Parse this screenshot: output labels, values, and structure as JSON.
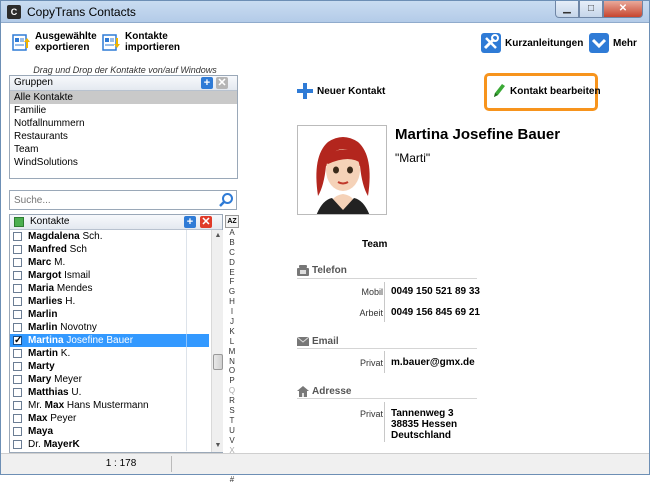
{
  "window": {
    "title": "CopyTrans Contacts",
    "icon": "C"
  },
  "toolbar": {
    "export_label_1": "Ausgewählte",
    "export_label_2": "exportieren",
    "import_label_1": "Kontakte",
    "import_label_2": "importieren",
    "guides_label": "Kurzanleitungen",
    "more_label": "Mehr"
  },
  "drag_note": "Drag und Drop der Kontakte von/auf Windows",
  "groups": {
    "header": "Gruppen",
    "items": [
      "Alle Kontakte",
      "Familie",
      "Notfallnummern",
      "Restaurants",
      "Team",
      "WindSolutions"
    ]
  },
  "search": {
    "placeholder": "Suche..."
  },
  "contacts": {
    "header": "Kontakte",
    "sort_label": "AZ",
    "rows": [
      {
        "bold": "Magdalena",
        "rest": " Sch.",
        "checked": false,
        "selected": false
      },
      {
        "bold": "Manfred",
        "rest": " Sch",
        "checked": false,
        "selected": false
      },
      {
        "bold": "Marc",
        "rest": " M.",
        "checked": false,
        "selected": false
      },
      {
        "bold": "Margot",
        "rest": " Ismail",
        "checked": false,
        "selected": false
      },
      {
        "bold": "Maria",
        "rest": " Mendes",
        "checked": false,
        "selected": false
      },
      {
        "bold": "Marlies",
        "rest": " H.",
        "checked": false,
        "selected": false
      },
      {
        "bold": "Marlin",
        "rest": "",
        "checked": false,
        "selected": false
      },
      {
        "bold": "Marlin",
        "rest": " Novotny",
        "checked": false,
        "selected": false
      },
      {
        "bold": "Martina",
        "rest": " Josefine Bauer",
        "checked": true,
        "selected": true
      },
      {
        "bold": "Martin",
        "rest": " K.",
        "checked": false,
        "selected": false
      },
      {
        "bold": "Marty",
        "rest": "",
        "checked": false,
        "selected": false
      },
      {
        "bold": "Mary",
        "rest": " Meyer",
        "checked": false,
        "selected": false
      },
      {
        "bold": "Matthias",
        "rest": " U.",
        "checked": false,
        "selected": false
      },
      {
        "pre": "Mr. ",
        "bold": "Max",
        "rest": " Hans Mustermann",
        "checked": false,
        "selected": false
      },
      {
        "bold": "Max",
        "rest": " Peyer",
        "checked": false,
        "selected": false
      },
      {
        "bold": "Maya",
        "rest": "",
        "checked": false,
        "selected": false
      },
      {
        "pre": "Dr. ",
        "bold": "MayerK",
        "rest": "",
        "checked": false,
        "selected": false
      }
    ]
  },
  "alphabet": [
    "A",
    "B",
    "C",
    "D",
    "E",
    "F",
    "G",
    "H",
    "I",
    "J",
    "K",
    "L",
    "M",
    "N",
    "O",
    "P",
    "Q",
    "R",
    "S",
    "T",
    "U",
    "V",
    "X",
    "Y",
    "Z",
    "#"
  ],
  "alphabet_dim": [
    "Q",
    "X"
  ],
  "status": {
    "count": "1 : 178"
  },
  "actions": {
    "new_contact": "Neuer Kontakt",
    "edit_contact": "Kontakt bearbeiten"
  },
  "detail": {
    "name": "Martina Josefine Bauer",
    "nickname": "\"Marti\"",
    "group": "Team",
    "phone_section": "Telefon",
    "phones": [
      {
        "label": "Mobil",
        "value": "0049 150 521 89 33"
      },
      {
        "label": "Arbeit",
        "value": "0049 156 845 69 21"
      }
    ],
    "email_section": "Email",
    "emails": [
      {
        "label": "Privat",
        "value": "m.bauer@gmx.de"
      }
    ],
    "address_section": "Adresse",
    "address": {
      "label": "Privat",
      "line1": "Tannenweg 3",
      "line2": "38835 Hessen",
      "line3": "Deutschland"
    }
  },
  "colors": {
    "accent_blue": "#2f7bd6",
    "highlight_orange": "#f7941d",
    "selection_blue": "#3399ff"
  }
}
